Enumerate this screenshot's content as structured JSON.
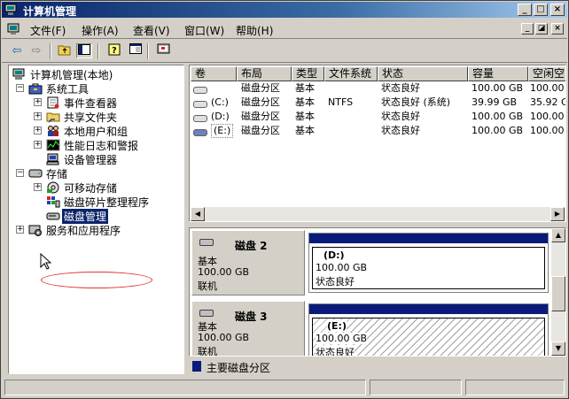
{
  "window": {
    "title": "计算机管理",
    "controls": {
      "minimize": "_",
      "maximize": "□",
      "close": "×"
    }
  },
  "menu": {
    "items": [
      "文件(F)",
      "操作(A)",
      "查看(V)",
      "窗口(W)",
      "帮助(H)"
    ],
    "mdi_controls": {
      "minimize": "_",
      "restore": "◪",
      "close": "×"
    }
  },
  "toolbar": {
    "icons": [
      "back-arrow-icon",
      "forward-arrow-icon",
      "up-folder-icon",
      "show-tree-icon",
      "help-icon",
      "properties-icon",
      "console-icon"
    ]
  },
  "tree": {
    "root": "计算机管理(本地)",
    "system_tools": "系统工具",
    "event_viewer": "事件查看器",
    "shared_folders": "共享文件夹",
    "local_users": "本地用户和组",
    "perf_logs": "性能日志和警报",
    "device_manager": "设备管理器",
    "storage": "存储",
    "removable_storage": "可移动存储",
    "defrag": "磁盘碎片整理程序",
    "disk_management": "磁盘管理",
    "services_apps": "服务和应用程序"
  },
  "volumes": {
    "columns": [
      "卷",
      "布局",
      "类型",
      "文件系统",
      "状态",
      "容量",
      "空闲空"
    ],
    "rows": [
      {
        "volume": "",
        "layout": "磁盘分区",
        "type": "基本",
        "fs": "",
        "status": "状态良好",
        "capacity": "100.00 GB",
        "free": "100.00"
      },
      {
        "volume": "(C:)",
        "layout": "磁盘分区",
        "type": "基本",
        "fs": "NTFS",
        "status": "状态良好 (系统)",
        "capacity": "39.99 GB",
        "free": "35.92 G"
      },
      {
        "volume": "(D:)",
        "layout": "磁盘分区",
        "type": "基本",
        "fs": "",
        "status": "状态良好",
        "capacity": "100.00 GB",
        "free": "100.00"
      },
      {
        "volume": "(E:)",
        "layout": "磁盘分区",
        "type": "基本",
        "fs": "",
        "status": "状态良好",
        "capacity": "100.00 GB",
        "free": "100.00"
      }
    ]
  },
  "disks": [
    {
      "name": "磁盘 2",
      "type": "基本",
      "size": "100.00 GB",
      "state": "联机",
      "partition": {
        "label": "(D:)",
        "size": "100.00 GB",
        "status": "状态良好"
      }
    },
    {
      "name": "磁盘 3",
      "type": "基本",
      "size": "100.00 GB",
      "state": "联机",
      "partition": {
        "label": "(E:)",
        "size": "100.00 GB",
        "status": "状态良好"
      }
    }
  ],
  "legend": {
    "primary_partition": "主要磁盘分区"
  },
  "colors": {
    "title_start": "#0a246a",
    "title_end": "#a6caf0",
    "partition_primary": "#0a1a7a",
    "selection": "#0a246a"
  }
}
